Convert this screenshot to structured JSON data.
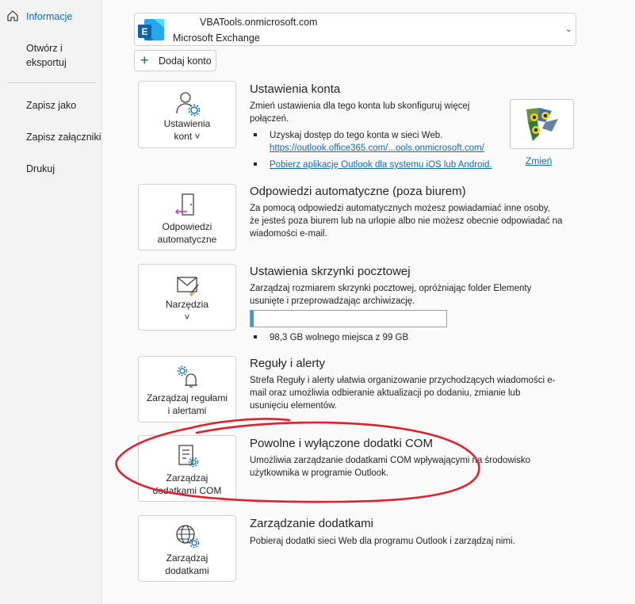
{
  "sidebar": {
    "items": [
      {
        "label": "Informacje",
        "active": true
      },
      {
        "label": "Otwórz i\neksportuj"
      },
      {
        "label": "Zapisz jako"
      },
      {
        "label": "Zapisz załączniki"
      },
      {
        "label": "Drukuj"
      }
    ]
  },
  "account": {
    "email": "VBATools.onmicrosoft.com",
    "type": "Microsoft Exchange",
    "add_label": "Dodaj konto"
  },
  "sections": {
    "account_settings": {
      "tile_label": "Ustawienia\nkont ˅",
      "title": "Ustawienia konta",
      "text": "Zmień ustawienia dla tego konta lub skonfiguruj więcej\npołączeń.",
      "bullet1": "Uzyskaj dostęp do tego konta w sieci Web.",
      "bullet1_link": "https://outlook.office365.com/...ools.onmicrosoft.com/",
      "bullet2_link": "Pobierz aplikację Outlook dla systemu iOS lub Android.",
      "change_label": "Zmień"
    },
    "auto_replies": {
      "tile_label": "Odpowiedzi\nautomatyczne",
      "title": "Odpowiedzi automatyczne (poza biurem)",
      "text": "Za pomocą odpowiedzi automatycznych możesz powiadamiać inne osoby,\nże jesteś poza biurem lub na urlopie albo nie możesz obecnie odpowiadać na\nwiadomości e-mail."
    },
    "mailbox": {
      "tile_label": "Narzędzia\n˅",
      "title": "Ustawienia skrzynki pocztowej",
      "text": "Zarządzaj rozmiarem skrzynki pocztowej, opróżniając folder Elementy\nusunięte i przeprowadzając archiwizację.",
      "storage_text": "98,3 GB wolnego miejsca z 99 GB",
      "storage_used_fraction": 0.007
    },
    "rules": {
      "tile_label": "Zarządzaj regułami\ni alertami",
      "title": "Reguły i alerty",
      "text": "Strefa Reguły i alerty ułatwia organizowanie przychodzących wiadomości e-\nmail oraz umożliwia odbieranie aktualizacji po dodaniu, zmianie lub\nusunięciu elementów."
    },
    "com": {
      "tile_label": "Zarządzaj\ndodatkami COM",
      "title": "Powolne i wyłączone dodatki COM",
      "text": "Umożliwia zarządzanie dodatkami COM wpływającymi na środowisko\nużytkownika w programie Outlook."
    },
    "addins": {
      "tile_label": "Zarządzaj\ndodatkami",
      "title": "Zarządzanie dodatkami",
      "text": "Pobieraj dodatki sieci Web dla programu Outlook i zarządzaj nimi."
    }
  },
  "colors": {
    "accent": "#0f6cbd",
    "annotation": "#e0202a",
    "storage_fill": "#2f9fd6"
  }
}
